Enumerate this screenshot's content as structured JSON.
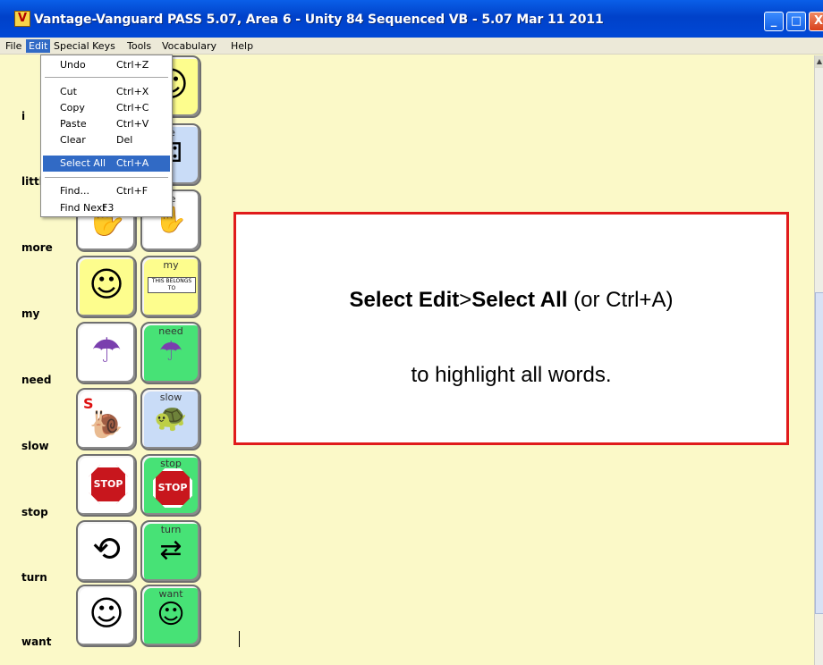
{
  "window": {
    "icon": "V",
    "title": "Vantage-Vanguard PASS 5.07, Area 6 - Unity 84 Sequenced VB - 5.07 Mar 11 2011",
    "buttons": {
      "minimize": "_",
      "maximize": "□",
      "close": "X"
    }
  },
  "menubar": {
    "items": [
      "File",
      "Edit",
      "Special Keys",
      "Tools",
      "Vocabulary",
      "Help"
    ]
  },
  "edit_menu": {
    "items": [
      {
        "label": "Undo",
        "shortcut": "Ctrl+Z"
      },
      {
        "label": "Cut",
        "shortcut": "Ctrl+X"
      },
      {
        "label": "Copy",
        "shortcut": "Ctrl+C"
      },
      {
        "label": "Paste",
        "shortcut": "Ctrl+V"
      },
      {
        "label": "Clear",
        "shortcut": "Del"
      },
      {
        "label": "Select All",
        "shortcut": "Ctrl+A"
      },
      {
        "label": "Find...",
        "shortcut": "Ctrl+F"
      },
      {
        "label": "Find Next",
        "shortcut": "F3"
      }
    ],
    "highlighted": "Select All"
  },
  "word_list": [
    "i",
    "littl",
    "more",
    "my",
    "need",
    "slow",
    "stop",
    "turn",
    "want"
  ],
  "keys": {
    "row_more": {
      "right_label": "re"
    },
    "row_little": {
      "right_label": "le"
    },
    "row_my": {
      "right_label": "my",
      "tag_text": "THIS BELONGS TO"
    },
    "row_need": {
      "right_label": "need"
    },
    "row_slow": {
      "left_label": "S",
      "right_label": "slow"
    },
    "row_stop": {
      "left_sign": "STOP",
      "right_label": "stop",
      "right_sign": "STOP"
    },
    "row_turn": {
      "right_label": "turn"
    },
    "row_want": {
      "right_label": "want"
    }
  },
  "callout": {
    "line1_part1": "Select Edit",
    "line1_sep": ">",
    "line1_part2": "Select All",
    "line1_suffix": " (or Ctrl+A)",
    "line2": "to highlight all words."
  },
  "colors": {
    "titlebar": "#0048d6",
    "callout_border": "#e01b1b",
    "menu_highlight": "#316ac5",
    "background": "#fbf9c8"
  }
}
